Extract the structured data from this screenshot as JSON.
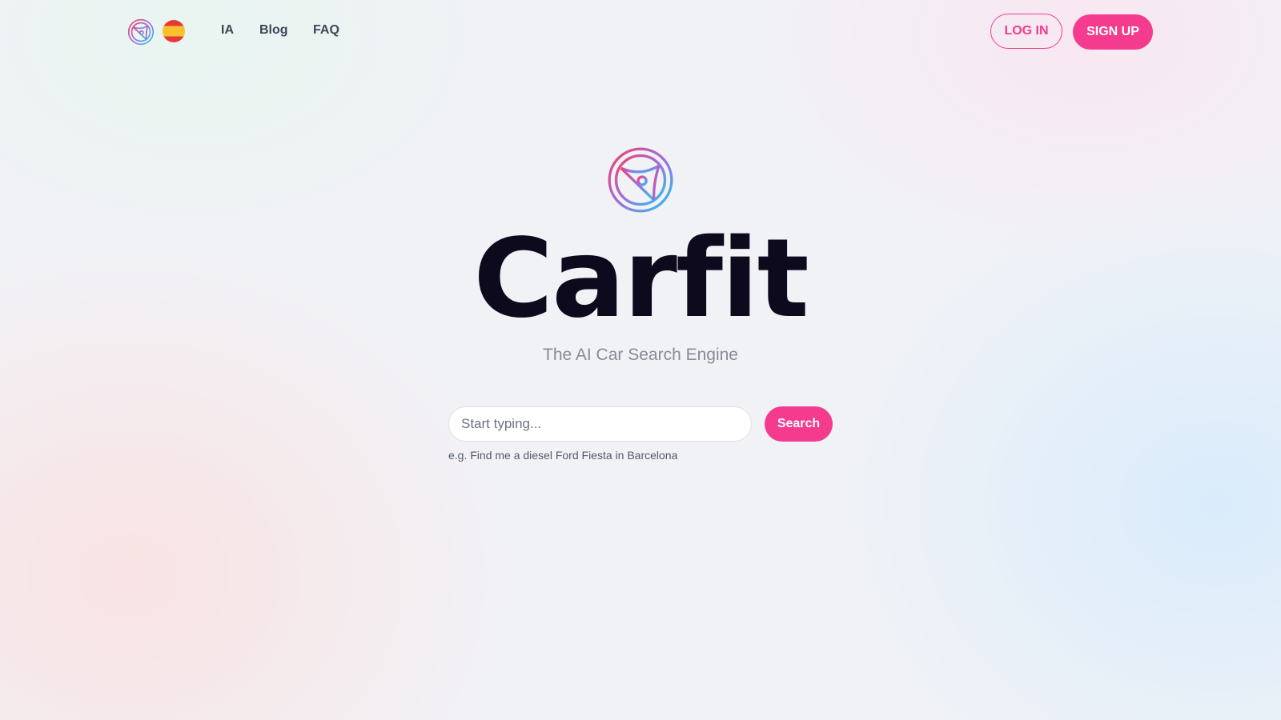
{
  "nav": {
    "links": [
      {
        "label": "IA"
      },
      {
        "label": "Blog"
      },
      {
        "label": "FAQ"
      }
    ],
    "language_flag": "spain-flag",
    "login_label": "LOG IN",
    "signup_label": "SIGN UP"
  },
  "hero": {
    "logo_icon": "steering-wheel-icon",
    "brand": "Carfit",
    "tagline": "The AI Car Search Engine"
  },
  "search": {
    "placeholder": "Start typing...",
    "value": "",
    "button_label": "Search",
    "example": "e.g. Find me a diesel Ford Fiesta in Barcelona"
  },
  "colors": {
    "accent": "#f43b8e",
    "text_dark": "#0c0a1c"
  }
}
